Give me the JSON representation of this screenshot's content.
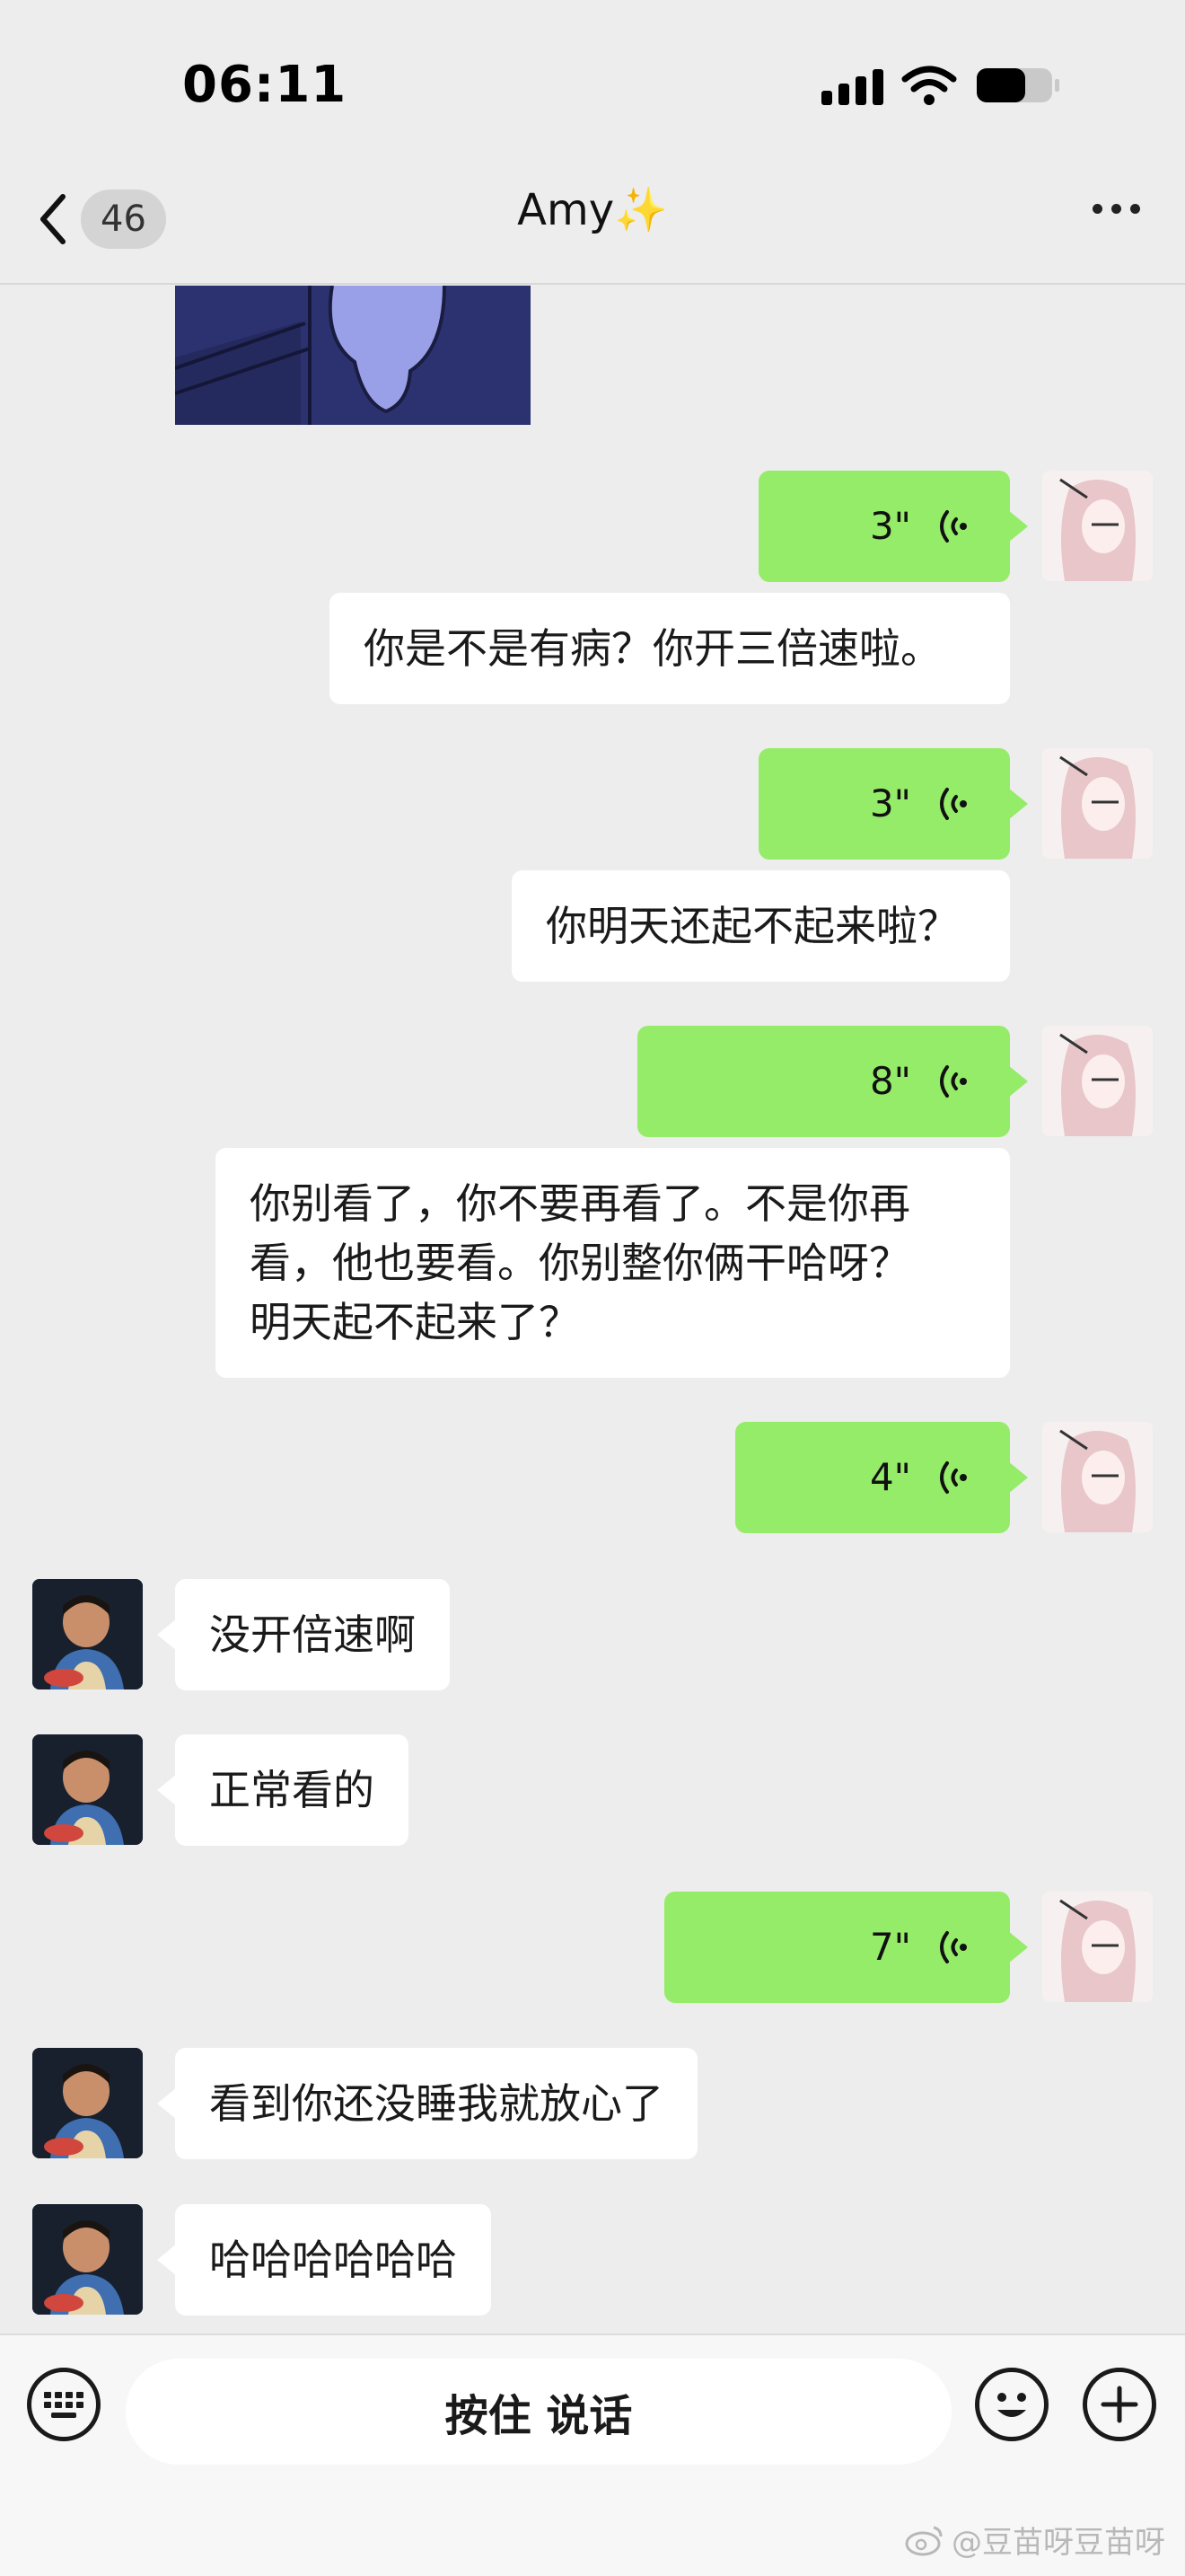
{
  "status_bar": {
    "time": "06:11"
  },
  "nav": {
    "back_count": "46",
    "title": "Amy✨"
  },
  "messages": [
    {
      "type": "voice",
      "from": "me",
      "duration": "3\"",
      "transcript": "你是不是有病？你开三倍速啦。"
    },
    {
      "type": "voice",
      "from": "me",
      "duration": "3\"",
      "transcript": "你明天还起不起来啦？"
    },
    {
      "type": "voice",
      "from": "me",
      "duration": "8\"",
      "transcript_lines": [
        "你别看了，你不要再看了。不是你再",
        "看，他也要看。你别整你俩干哈呀？",
        "明天起不起来了？"
      ]
    },
    {
      "type": "voice",
      "from": "me",
      "duration": "4\""
    },
    {
      "type": "text",
      "from": "other",
      "text": "没开倍速啊"
    },
    {
      "type": "text",
      "from": "other",
      "text": "正常看的"
    },
    {
      "type": "voice",
      "from": "me",
      "duration": "7\""
    },
    {
      "type": "text",
      "from": "other",
      "text": "看到你还没睡我就放心了"
    },
    {
      "type": "text",
      "from": "other",
      "text": "哈哈哈哈哈哈"
    }
  ],
  "input_bar": {
    "hold_to_talk": "按住 说话"
  },
  "watermark": "@豆苗呀豆苗呀",
  "colors": {
    "background": "#ededed",
    "my_bubble": "#95ec69",
    "other_bubble": "#ffffff"
  },
  "icons": [
    "back-chevron-icon",
    "more-dots-icon",
    "voice-wave-icon",
    "keyboard-icon",
    "emoji-icon",
    "plus-icon",
    "weibo-icon"
  ]
}
